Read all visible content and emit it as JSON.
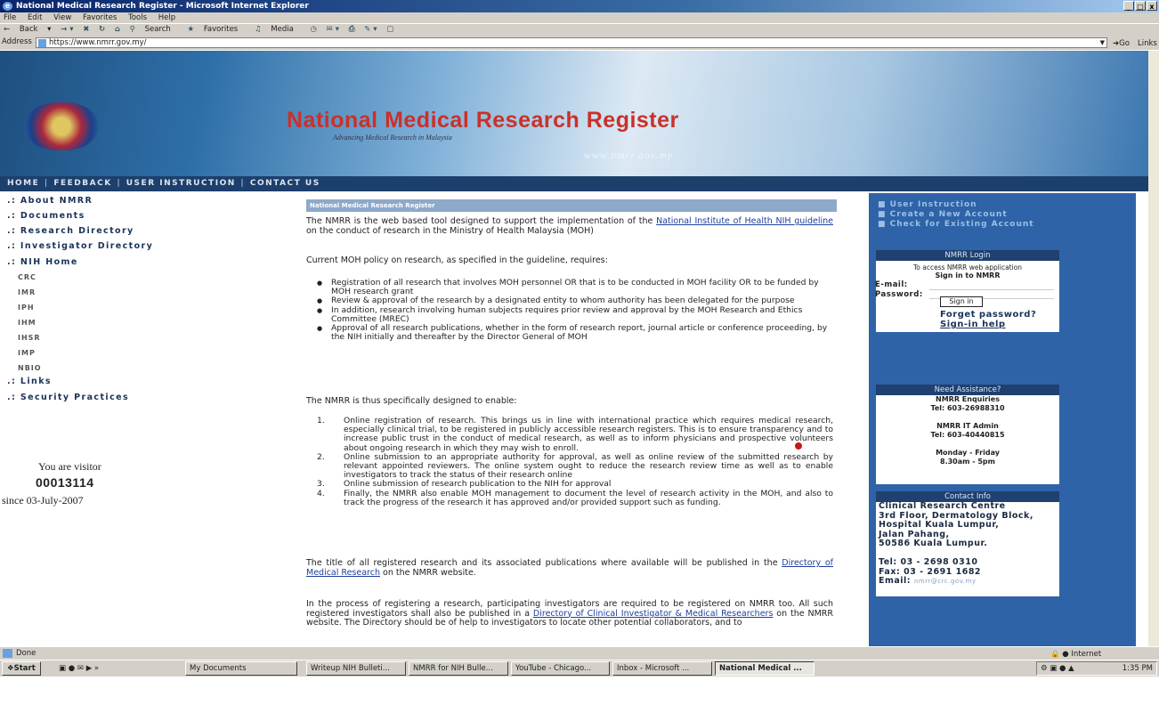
{
  "window": {
    "title": "National Medical Research Register - Microsoft Internet Explorer",
    "controls": [
      "_",
      "□",
      "x"
    ]
  },
  "menu": [
    "File",
    "Edit",
    "View",
    "Favorites",
    "Tools",
    "Help"
  ],
  "toolbar": {
    "back": "Back",
    "search": "Search",
    "favorites": "Favorites",
    "media": "Media"
  },
  "address": {
    "label": "Address",
    "url": "https://www.nmrr.gov.my/",
    "go": "Go",
    "links": "Links"
  },
  "banner": {
    "title": "National Medical Research Register",
    "subtitle": "Advancing Medical Research in Malaysia",
    "url": "www.nmrr.gov.my"
  },
  "nav": [
    "HOME",
    "FEEDBACK",
    "USER INSTRUCTION",
    "CONTACT US"
  ],
  "left_menu": {
    "items": [
      ".: About NMRR",
      ".: Documents",
      ".: Research Directory",
      ".: Investigator Directory",
      ".: NIH Home"
    ],
    "sub_items": [
      "CRC",
      "IMR",
      "IPH",
      "IHM",
      "IHSR",
      "IMP",
      "NBIO"
    ],
    "items2": [
      ".: Links",
      ".: Security Practices"
    ]
  },
  "visitor": {
    "label": "You are visitor",
    "count": "00013114",
    "since": "since 03-July-2007"
  },
  "main": {
    "crumb": "National Medical Research Register",
    "intro_pre": "The NMRR is the web based tool designed to support the implementation of the ",
    "intro_link": "National Institute of Health NIH guideline",
    "intro_post": " on the conduct of research in the Ministry of Health Malaysia (MOH)",
    "policy": "Current MOH policy on research, as specified in the guideline, requires:",
    "bullets": [
      "Registration of all research that involves MOH personnel OR that is to be conducted in MOH facility OR to be funded by MOH research grant",
      "Review & approval of the research by a designated entity to whom authority has been delegated for the purpose",
      "In addition, research involving human subjects requires prior review and approval by the MOH Research and Ethics Committee (MREC)",
      "Approval of all research publications, whether in the form of research report, journal article or conference proceeding, by the NIH initially and thereafter by the Director General of MOH"
    ],
    "enable": "The NMRR is thus specifically designed to enable:",
    "numbered": [
      "Online registration of research. This brings us in line with international practice which requires medical research, especially clinical trial, to be registered in publicly accessible research registers. This is to ensure transparency and to increase public trust in the conduct of medical research, as well as to inform physicians and prospective volunteers about ongoing research in which they may wish to enroll.",
      "Online submission to an appropriate authority for approval, as well as online review of the submitted research by relevant appointed reviewers. The online system ought to reduce the research review time as well as to enable investigators to track the status of their research online",
      "Online submission of research publication to the NIH for approval",
      "Finally, the NMRR also enable MOH management to document the level of research activity in the MOH, and also to track the progress of the research it has approved and/or provided support such as funding."
    ],
    "title_pre": "The title of all registered research and its associated publications where available will be published in the ",
    "title_link": "Directory of Medical Research",
    "title_post": " on the NMRR website.",
    "process_pre": "In the process of registering a research, participating investigators are required to be registered on NMRR too. All such registered investigators shall also be published in a ",
    "process_link": "Directory of Clinical Investigator & Medical Researchers",
    "process_post": " on the NMRR website. The Directory should be of help to investigators to locate other potential collaborators, and to"
  },
  "right": {
    "links": [
      "User Instruction",
      "Create a New Account",
      "Check for Existing Account"
    ],
    "login": {
      "header": "NMRR Login",
      "line1": "To access NMRR web application",
      "line2": "Sign in to NMRR",
      "email_label": "E-mail:",
      "password_label": "Password:",
      "button": "Sign in",
      "forgot": "Forget password?",
      "help": "Sign-in help"
    },
    "assist": {
      "header": "Need Assistance?",
      "lines": [
        "NMRR Enquiries",
        "Tel: 603-26988310",
        "",
        "NMRR IT Admin",
        "Tel: 603-40440815",
        "",
        "Monday - Friday",
        "8.30am - 5pm"
      ]
    },
    "contact": {
      "header": "Contact Info",
      "lines": [
        "Clinical Research Centre",
        "3rd Floor, Dermatology Block,",
        "Hospital Kuala Lumpur,",
        "Jalan Pahang,",
        "50586 Kuala Lumpur.",
        "",
        "Tel: 03 - 2698 0310",
        "Fax: 03 - 2691 1682"
      ],
      "email_label": "Email:",
      "email_value": "nmrr@crc.gov.my"
    }
  },
  "status": {
    "text": "Done",
    "zone": "Internet"
  },
  "taskbar": {
    "start": "Start",
    "buttons": [
      "My Documents",
      "Writeup NIH Bulleti...",
      "NMRR for NIH Bulle...",
      "YouTube - Chicago...",
      "Inbox - Microsoft ...",
      "National Medical ..."
    ],
    "clock": "1:35 PM"
  },
  "colors": {
    "nav_bg": "#1c3f6c",
    "right_bg": "#2f63a8",
    "title_red": "#c9312a",
    "link": "#1f3f9c"
  }
}
